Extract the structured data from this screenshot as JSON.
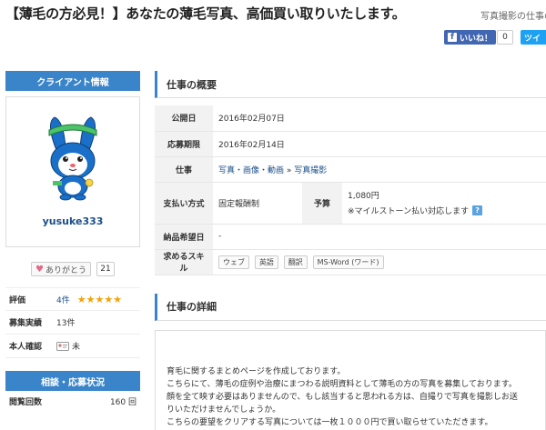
{
  "header": {
    "title": "【薄毛の方必見！】あなたの薄毛写真、高価買い取りいたします。",
    "tagline": "写真撮影の仕事の"
  },
  "social": {
    "fb_label": "いいね！",
    "fb_count": "0",
    "tw_label": "ツイ"
  },
  "client": {
    "header": "クライアント情報",
    "username": "yusuke333",
    "thanks_label": "ありがとう",
    "thanks_count": "21",
    "stats": [
      {
        "label": "評価",
        "value": "4件",
        "stars": "★★★★★"
      },
      {
        "label": "募集実績",
        "value": "13件"
      },
      {
        "label": "本人確認",
        "value": "未"
      }
    ],
    "apply_header": "相談・応募状況",
    "views_label": "閲覧回数",
    "views_value": "160 回"
  },
  "overview": {
    "title": "仕事の概要",
    "published_label": "公開日",
    "published_value": "2016年02月07日",
    "deadline_label": "応募期限",
    "deadline_value": "2016年02月14日",
    "job_label": "仕事",
    "job_category": "写真・画像・動画",
    "job_sep": " » ",
    "job_sub": "写真撮影",
    "payment_label": "支払い方式",
    "payment_value": "固定報酬制",
    "budget_label": "予算",
    "budget_value": "1,080円",
    "budget_note": "※マイルストーン払い対応します",
    "help_glyph": "?",
    "delivery_label": "納品希望日",
    "delivery_value": "-",
    "skills_label": "求めるスキル",
    "skills": [
      "ウェブ",
      "英語",
      "翻訳",
      "MS-Word (ワード)"
    ]
  },
  "details": {
    "title": "仕事の詳細",
    "lines": [
      "育毛に関するまとめページを作成しております。",
      "こちらにて、薄毛の症例や治療にまつわる説明資料として薄毛の方の写真を募集しております。",
      "顔を全て映す必要はありませんので、もし該当すると思われる方は、自撮りで写真を撮影しお送",
      "りいただけませんでしょうか。",
      "こちらの要望をクリアする写真については一枚１０００円で買い取らせていただきます。"
    ]
  },
  "colors": {
    "accent": "#3a84c9",
    "star": "#f4a10b",
    "link": "#1a4f8a"
  }
}
